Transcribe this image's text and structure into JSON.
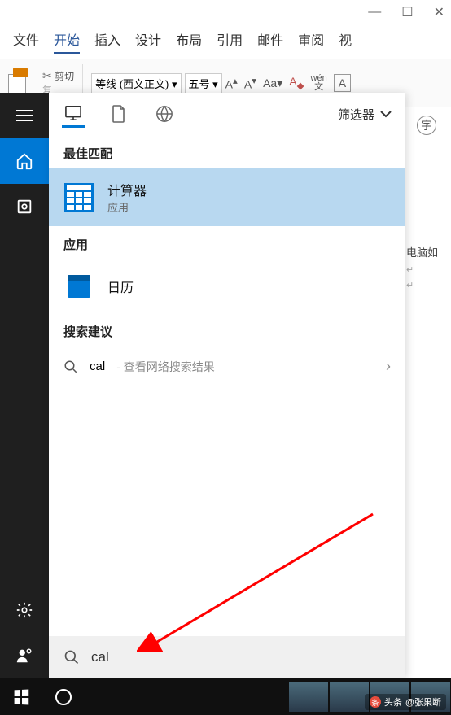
{
  "word": {
    "window_controls": {
      "min": "—",
      "max": "☐",
      "close": "✕"
    },
    "tabs": [
      "文件",
      "开始",
      "插入",
      "设计",
      "布局",
      "引用",
      "邮件",
      "审阅",
      "视"
    ],
    "clipboard": {
      "cut": "剪切",
      "copy_prefix": "复"
    },
    "font_name": "等线 (西文正文)",
    "font_size": "五号",
    "wen_label": "wén",
    "char_border": "A",
    "circled_char": "字",
    "doc_text": "电脑如"
  },
  "start_sidebar": {
    "items": [
      "menu",
      "home",
      "timeline"
    ],
    "bottom": [
      "settings",
      "account"
    ]
  },
  "search_panel": {
    "filter_label": "筛选器",
    "sections": {
      "best_match": "最佳匹配",
      "apps": "应用",
      "suggestions": "搜索建议"
    },
    "results": {
      "calculator": {
        "title": "计算器",
        "subtitle": "应用"
      },
      "calendar": {
        "title": "日历"
      }
    },
    "suggestion": {
      "query": "cal",
      "hint": " - 查看网络搜索结果"
    },
    "search_input": "cal"
  },
  "watermark": {
    "prefix": "头条",
    "author": "@张果断"
  }
}
